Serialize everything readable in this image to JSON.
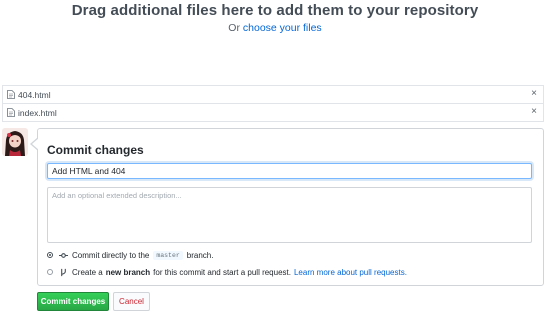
{
  "upload": {
    "title": "Drag additional files here to add them to your repository",
    "or_text": "Or",
    "choose_link": "choose your files"
  },
  "files": [
    {
      "name": "404.html",
      "remove": "×"
    },
    {
      "name": "index.html",
      "remove": "×"
    }
  ],
  "commit": {
    "title": "Commit changes",
    "summary_value": "Add HTML and 404",
    "description_placeholder": "Add an optional extended description...",
    "option_direct": {
      "prefix": "Commit directly to the",
      "branch": "master",
      "suffix": "branch."
    },
    "option_new": {
      "prefix": "Create a",
      "bold": "new branch",
      "suffix": "for this commit and start a pull request.",
      "link": "Learn more about pull requests."
    },
    "commit_button": "Commit changes",
    "cancel_button": "Cancel"
  },
  "icons": {
    "file": "file-icon",
    "remove": "close-icon",
    "commit": "git-commit-icon",
    "branch": "git-branch-icon"
  },
  "colors": {
    "link": "#0366d6",
    "commit_button": "#28a745",
    "cancel_text": "#cb2431",
    "focus_border": "#79b8ff"
  }
}
